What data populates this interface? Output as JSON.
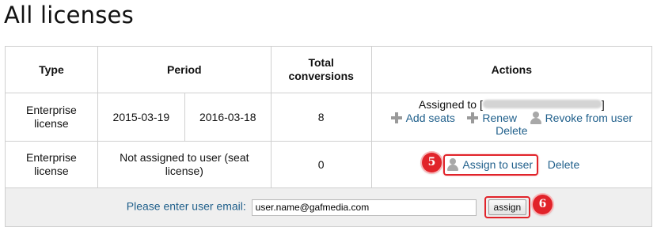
{
  "page": {
    "title": "All licenses"
  },
  "table": {
    "headers": {
      "type": "Type",
      "period": "Period",
      "conversions": "Total conversions",
      "actions": "Actions"
    },
    "rows": [
      {
        "type": "Enterprise license",
        "period_start": "2015-03-19",
        "period_end": "2016-03-18",
        "conversions": "8",
        "assigned_prefix": "Assigned to [",
        "assigned_suffix": "]",
        "actions": {
          "add_seats": "Add seats",
          "renew": "Renew",
          "revoke": "Revoke from user",
          "delete": "Delete"
        }
      },
      {
        "type": "Enterprise license",
        "period": "Not assigned to user (seat license)",
        "conversions": "0",
        "actions": {
          "assign": "Assign to user",
          "delete": "Delete"
        },
        "step_badge": "5"
      }
    ]
  },
  "email_row": {
    "label": "Please enter user email:",
    "value": "user.name@gafmedia.com",
    "button": "assign",
    "step_badge": "6"
  },
  "colors": {
    "link": "#1f5f8b",
    "highlight": "#e1232a"
  },
  "icons": [
    "plus-icon",
    "user-icon"
  ]
}
